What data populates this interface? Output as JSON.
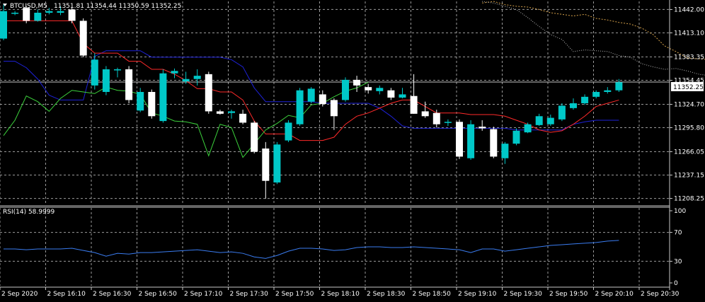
{
  "header": {
    "symbol_timeframe": "BTCUSD,M5",
    "ohlc": "11351.81 11354.44 11350.59 11352.25"
  },
  "rsi_panel": {
    "label": "RSI(14) 58.9999"
  },
  "current_price": "11352.25",
  "colors": {
    "background": "#000000",
    "grid": "#9a9a9a",
    "bull_candle": "#00c8c8",
    "bear_candle": "#ffffff",
    "tenkan": "#ff2a2a",
    "kijun": "#1e22d8",
    "chikou": "#3cd23c",
    "cloud_a": "#d4a04a",
    "cloud_b": "#b8b8b8",
    "rsi_line": "#3a7cf0"
  },
  "chart_data": [
    {
      "type": "candlestick",
      "title": "BTCUSD,M5",
      "y_range": [
        11200,
        11452
      ],
      "y_ticks": [
        "11442.00",
        "11413.10",
        "11383.35",
        "11354.45",
        "11324.70",
        "11295.80",
        "11266.05",
        "11237.15",
        "11208.25"
      ],
      "x_ticks": [
        "2 Sep 2020",
        "2 Sep 16:10",
        "2 Sep 16:30",
        "2 Sep 16:50",
        "2 Sep 17:10",
        "2 Sep 17:30",
        "2 Sep 17:50",
        "2 Sep 18:10",
        "2 Sep 18:30",
        "2 Sep 18:50",
        "2 Sep 19:10",
        "2 Sep 19:30",
        "2 Sep 19:50",
        "2 Sep 20:10",
        "2 Sep 20:30"
      ],
      "candles": [
        {
          "o": 11406,
          "h": 11448,
          "l": 11404,
          "c": 11440
        },
        {
          "o": 11437,
          "h": 11440,
          "l": 11435,
          "c": 11438
        },
        {
          "o": 11444,
          "h": 11446,
          "l": 11425,
          "c": 11428
        },
        {
          "o": 11428,
          "h": 11442,
          "l": 11427,
          "c": 11438
        },
        {
          "o": 11438,
          "h": 11444,
          "l": 11436,
          "c": 11440
        },
        {
          "o": 11438,
          "h": 11446,
          "l": 11435,
          "c": 11440
        },
        {
          "o": 11442,
          "h": 11444,
          "l": 11425,
          "c": 11428
        },
        {
          "o": 11428,
          "h": 11431,
          "l": 11383,
          "c": 11385
        },
        {
          "o": 11348,
          "h": 11388,
          "l": 11343,
          "c": 11380
        },
        {
          "o": 11340,
          "h": 11372,
          "l": 11336,
          "c": 11368
        },
        {
          "o": 11368,
          "h": 11370,
          "l": 11358,
          "c": 11368
        },
        {
          "o": 11368,
          "h": 11372,
          "l": 11326,
          "c": 11330
        },
        {
          "o": 11317,
          "h": 11345,
          "l": 11315,
          "c": 11340
        },
        {
          "o": 11340,
          "h": 11343,
          "l": 11307,
          "c": 11310
        },
        {
          "o": 11304,
          "h": 11368,
          "l": 11302,
          "c": 11363
        },
        {
          "o": 11363,
          "h": 11369,
          "l": 11357,
          "c": 11366
        },
        {
          "o": 11353,
          "h": 11365,
          "l": 11350,
          "c": 11356
        },
        {
          "o": 11356,
          "h": 11368,
          "l": 11348,
          "c": 11360
        },
        {
          "o": 11362,
          "h": 11365,
          "l": 11313,
          "c": 11316
        },
        {
          "o": 11316,
          "h": 11318,
          "l": 11312,
          "c": 11313
        },
        {
          "o": 11314,
          "h": 11318,
          "l": 11307,
          "c": 11316
        },
        {
          "o": 11313,
          "h": 11318,
          "l": 11300,
          "c": 11302
        },
        {
          "o": 11302,
          "h": 11304,
          "l": 11264,
          "c": 11266
        },
        {
          "o": 11270,
          "h": 11278,
          "l": 11208,
          "c": 11230
        },
        {
          "o": 11228,
          "h": 11278,
          "l": 11226,
          "c": 11275
        },
        {
          "o": 11280,
          "h": 11305,
          "l": 11278,
          "c": 11302
        },
        {
          "o": 11300,
          "h": 11345,
          "l": 11298,
          "c": 11342
        },
        {
          "o": 11328,
          "h": 11346,
          "l": 11326,
          "c": 11344
        },
        {
          "o": 11337,
          "h": 11342,
          "l": 11322,
          "c": 11325
        },
        {
          "o": 11330,
          "h": 11332,
          "l": 11293,
          "c": 11310
        },
        {
          "o": 11330,
          "h": 11358,
          "l": 11328,
          "c": 11355
        },
        {
          "o": 11355,
          "h": 11360,
          "l": 11340,
          "c": 11348
        },
        {
          "o": 11346,
          "h": 11350,
          "l": 11338,
          "c": 11342
        },
        {
          "o": 11341,
          "h": 11348,
          "l": 11337,
          "c": 11345
        },
        {
          "o": 11342,
          "h": 11345,
          "l": 11330,
          "c": 11333
        },
        {
          "o": 11333,
          "h": 11345,
          "l": 11332,
          "c": 11337
        },
        {
          "o": 11335,
          "h": 11362,
          "l": 11313,
          "c": 11313
        },
        {
          "o": 11316,
          "h": 11328,
          "l": 11308,
          "c": 11310
        },
        {
          "o": 11314,
          "h": 11318,
          "l": 11296,
          "c": 11300
        },
        {
          "o": 11302,
          "h": 11306,
          "l": 11298,
          "c": 11303
        },
        {
          "o": 11303,
          "h": 11306,
          "l": 11257,
          "c": 11260
        },
        {
          "o": 11258,
          "h": 11305,
          "l": 11256,
          "c": 11300
        },
        {
          "o": 11297,
          "h": 11305,
          "l": 11292,
          "c": 11295
        },
        {
          "o": 11294,
          "h": 11297,
          "l": 11258,
          "c": 11260
        },
        {
          "o": 11258,
          "h": 11278,
          "l": 11251,
          "c": 11276
        },
        {
          "o": 11276,
          "h": 11295,
          "l": 11274,
          "c": 11292
        },
        {
          "o": 11290,
          "h": 11302,
          "l": 11289,
          "c": 11300
        },
        {
          "o": 11299,
          "h": 11313,
          "l": 11298,
          "c": 11310
        },
        {
          "o": 11300,
          "h": 11312,
          "l": 11298,
          "c": 11308
        },
        {
          "o": 11306,
          "h": 11326,
          "l": 11304,
          "c": 11323
        },
        {
          "o": 11320,
          "h": 11332,
          "l": 11318,
          "c": 11326
        },
        {
          "o": 11326,
          "h": 11337,
          "l": 11324,
          "c": 11334
        },
        {
          "o": 11334,
          "h": 11342,
          "l": 11332,
          "c": 11340
        },
        {
          "o": 11340,
          "h": 11346,
          "l": 11338,
          "c": 11342
        },
        {
          "o": 11342,
          "h": 11356,
          "l": 11340,
          "c": 11352
        }
      ],
      "tenkan": [
        11428,
        11428,
        11428,
        11428,
        11428,
        11428,
        11428,
        11400,
        11388,
        11388,
        11388,
        11378,
        11378,
        11368,
        11368,
        11362,
        11354,
        11344,
        11344,
        11340,
        11340,
        11330,
        11304,
        11288,
        11288,
        11288,
        11280,
        11280,
        11280,
        11284,
        11300,
        11310,
        11314,
        11320,
        11326,
        11330,
        11330,
        11322,
        11314,
        11314,
        11314,
        11312,
        11312,
        11312,
        11310,
        11305,
        11300,
        11293,
        11290,
        11292,
        11300,
        11310,
        11322,
        11326,
        11330
      ],
      "kijun": [
        11378,
        11378,
        11370,
        11356,
        11336,
        11330,
        11330,
        11330,
        11384,
        11391,
        11391,
        11391,
        11391,
        11383,
        11383,
        11383,
        11383,
        11383,
        11383,
        11383,
        11380,
        11371,
        11345,
        11328,
        11328,
        11328,
        11328,
        11328,
        11326,
        11326,
        11326,
        11326,
        11326,
        11320,
        11310,
        11298,
        11295,
        11295,
        11295,
        11295,
        11295,
        11295,
        11295,
        11295,
        11295,
        11293,
        11293,
        11293,
        11293,
        11293,
        11300,
        11303,
        11305,
        11305,
        11305
      ],
      "chikou": [
        11286,
        11305,
        11335,
        11328,
        11316,
        11332,
        11342,
        11340,
        11338,
        11346,
        11342,
        11341,
        11337,
        11314,
        11310,
        11304,
        11303,
        11300,
        11261,
        11300,
        11296,
        11259,
        11276,
        11293,
        11301,
        11311,
        11308,
        11324,
        11326,
        11334,
        11341,
        11345,
        11352
      ],
      "span_a": [
        11450,
        11452,
        11448,
        11446,
        11445,
        11442,
        11438,
        11436,
        11434,
        11436,
        11431,
        11429,
        11426,
        11424,
        11419,
        11411,
        11397,
        11390,
        11382,
        11381,
        11380,
        11374,
        11382,
        11390,
        11391,
        11390,
        11387,
        11378,
        11368,
        11360,
        11357,
        11355,
        11350,
        11344,
        11338,
        11333,
        11332,
        11330,
        11325
      ],
      "span_b": [
        11452,
        11450,
        11446,
        11442,
        11432,
        11421,
        11411,
        11405,
        11390,
        11392,
        11391,
        11390,
        11385,
        11383,
        11375,
        11371,
        11368,
        11369,
        11366,
        11362,
        11360,
        11358,
        11356,
        11355,
        11354,
        11354,
        11353,
        11352,
        11350,
        11350,
        11348,
        11346,
        11342,
        11340,
        11337,
        11332,
        11330,
        11328,
        11325
      ]
    },
    {
      "type": "line",
      "title": "RSI(14) 58.9999",
      "y_range": [
        0,
        100
      ],
      "y_ticks": [
        "100",
        "70",
        "30",
        "0"
      ],
      "values": [
        47,
        47,
        46,
        47,
        47,
        47,
        48,
        45,
        42,
        37,
        41,
        40,
        42,
        42,
        43,
        44,
        45,
        46,
        44,
        42,
        43,
        41,
        36,
        34,
        38,
        44,
        48,
        48,
        47,
        45,
        46,
        49,
        50,
        50,
        49,
        49,
        50,
        49,
        48,
        47,
        46,
        42,
        47,
        47,
        44,
        46,
        48,
        50,
        52,
        53,
        54,
        55,
        56,
        58,
        59
      ]
    }
  ]
}
